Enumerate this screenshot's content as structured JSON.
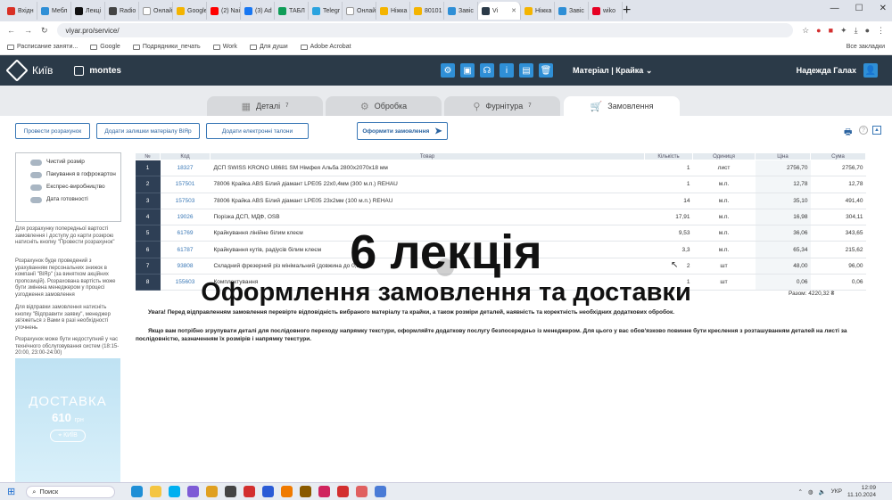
{
  "browser": {
    "tabs": [
      {
        "label": "Вхідн",
        "color": "#d93025"
      },
      {
        "label": "Мебл",
        "color": "#2f8fd6"
      },
      {
        "label": "Лекці",
        "color": "#111111"
      },
      {
        "label": "Radio",
        "color": "#444444"
      },
      {
        "label": "Онлай",
        "color": "#ffffff"
      },
      {
        "label": "Google",
        "color": "#f4b400"
      },
      {
        "label": "(2) Nai",
        "color": "#ff0000"
      },
      {
        "label": "(3) Ad",
        "color": "#1877f2"
      },
      {
        "label": "ТАБЛ",
        "color": "#0f9d58"
      },
      {
        "label": "Telegr",
        "color": "#2aa3df"
      },
      {
        "label": "Онлай",
        "color": "#ffffff"
      },
      {
        "label": "Ніжка",
        "color": "#f4b400"
      },
      {
        "label": "80101",
        "color": "#f4b400"
      },
      {
        "label": "Завіс",
        "color": "#2f8fd6"
      },
      {
        "label": "Vi",
        "color": "#2b3a48",
        "active": true
      },
      {
        "label": "Ніжка",
        "color": "#f4b400"
      },
      {
        "label": "Завіс",
        "color": "#2f8fd6"
      },
      {
        "label": "wiko",
        "color": "#e60023"
      }
    ],
    "new_tab": "+",
    "window_controls": [
      "—",
      "☐",
      "✕"
    ],
    "url": "viyar.pro/service/",
    "bookmarks": [
      {
        "label": "Расписание заняти...",
        "icon": "calendar-icon"
      },
      {
        "label": "Google",
        "icon": "google-icon"
      },
      {
        "label": "Подрядники_печать",
        "icon": "folder-icon"
      },
      {
        "label": "Work",
        "icon": "folder-icon"
      },
      {
        "label": "Для души",
        "icon": "folder-icon"
      },
      {
        "label": "Adobe Acrobat",
        "icon": "acrobat-icon"
      }
    ],
    "bookmarks_all": "Все закладки"
  },
  "app": {
    "city": "Київ",
    "brand": "montes",
    "material_menu": "Матеріал | Крайка",
    "user_name": "Надежда Галах",
    "toolbar_icons": [
      "settings-icon",
      "save-icon",
      "support-icon",
      "info-icon",
      "document-icon",
      "delete-icon"
    ]
  },
  "steps": [
    {
      "label": "Деталі",
      "count": "7",
      "icon": "grid-icon"
    },
    {
      "label": "Обробка",
      "count": "",
      "icon": "gear-icon"
    },
    {
      "label": "Фурнітура",
      "count": "7",
      "icon": "handle-icon"
    },
    {
      "label": "Замовлення",
      "count": "",
      "icon": "cart-icon",
      "active": true
    }
  ],
  "actions": {
    "calc": "Провести розрахунок",
    "add_leftovers": "Додати залишки матеріалу ВіЯр",
    "add_labels": "Додати електронні талони",
    "checkout": "Оформити замовлення"
  },
  "filters": [
    {
      "label": "Чистий розмір"
    },
    {
      "label": "Пакування в гофрокартон"
    },
    {
      "label": "Експрес-виробництво"
    },
    {
      "label": "Дата готовності"
    }
  ],
  "side_notes": [
    "Для розрахунку попередньої вартості замовлення і доступу до карти розкрою натисніть кнопку \"Провести розрахунок\"",
    "Розрахунок буде проведений з урахуванням персональних знижок в компанії \"ВіЯр\" (за винятком акційних пропозицій). Розрахована вартість може бути змінена менеджером у процесі узгодження замовлення",
    "Для відправки замовлення натисніть кнопку \"Відправити заявку\", менеджер зв'яжеться з Вами в разі необхідності уточнень",
    "Розрахунок може бути недоступний у час технічного обслуговування систем (18:15-20:00, 23:00-24:00)"
  ],
  "promo": {
    "title": "ДОСТАВКА",
    "price": "610",
    "currency": "грн",
    "city": "КИЇВ"
  },
  "table": {
    "headers": [
      "№",
      "Код",
      "Товар",
      "Кількість",
      "Одиниця",
      "Ціна",
      "Сума"
    ],
    "rows": [
      {
        "n": "1",
        "code": "18327",
        "name": "ДСП SWISS KRONO U8681 SM Німфея Альба 2800x2070x18 мм",
        "qty": "1",
        "unit": "лист",
        "price": "2756,70",
        "sum": "2756,70"
      },
      {
        "n": "2",
        "code": "157501",
        "name": "78006 Крайка ABS Білий діамант LPE05 22x0,4мм (300 м.п.) REHAU",
        "qty": "1",
        "unit": "м.п.",
        "price": "12,78",
        "sum": "12,78"
      },
      {
        "n": "3",
        "code": "157503",
        "name": "78006 Крайка ABS Білий діамант LPE05 23x2мм (100 м.п.) REHAU",
        "qty": "14",
        "unit": "м.п.",
        "price": "35,10",
        "sum": "491,40"
      },
      {
        "n": "4",
        "code": "19026",
        "name": "Порізка ДСП, МДФ, OSB",
        "qty": "17,91",
        "unit": "м.п.",
        "price": "16,98",
        "sum": "304,11"
      },
      {
        "n": "5",
        "code": "61769",
        "name": "Крайкування лінійне білим клеєм",
        "qty": "9,53",
        "unit": "м.п.",
        "price": "36,06",
        "sum": "343,65"
      },
      {
        "n": "6",
        "code": "61787",
        "name": "Крайкування кутів, радіусів білим клеєм",
        "qty": "3,3",
        "unit": "м.п.",
        "price": "65,34",
        "sum": "215,62"
      },
      {
        "n": "7",
        "code": "93808",
        "name": "Складний фрезерний різ мінімальний (довжина до 0,1м)",
        "qty": "2",
        "unit": "шт",
        "price": "48,00",
        "sum": "96,00"
      },
      {
        "n": "8",
        "code": "155603",
        "name": "Комплектування",
        "qty": "1",
        "unit": "шт",
        "price": "0,06",
        "sum": "0,06"
      }
    ],
    "total": "Разом: 4220,32 ₴"
  },
  "notes": {
    "warning": "Увага! Перед відправленням замовлення перевірте відповідність вибраного матеріалу та крайки, а також розміри деталей, наявність та коректність необхідних додаткових обробок.",
    "grouping": "Якщо вам потрібно згрупувати деталі для послідовного переходу напрямку текстури, оформляйте додаткову послугу безпосередньо із менеджером. Для цього у вас обов'язково повинне бути креслення з розташуванням деталей на листі за послідовністю, зазначенням їх розмірів і напрямку текстури."
  },
  "overlay": {
    "title": "6 лекція",
    "subtitle": "Оформлення замовлення та доставки"
  },
  "taskbar": {
    "search": "Поиск",
    "lang": "УКР",
    "time": "12:09",
    "date": "11.10.2024",
    "apps": [
      {
        "name": "edge-icon",
        "color": "#1f8fd6"
      },
      {
        "name": "explorer-icon",
        "color": "#f4c542"
      },
      {
        "name": "skype-icon",
        "color": "#00aff0"
      },
      {
        "name": "viber-icon",
        "color": "#7d5bd6"
      },
      {
        "name": "chrome-icon",
        "color": "#e0a020"
      },
      {
        "name": "app-icon",
        "color": "#444444"
      },
      {
        "name": "acrobat-icon",
        "color": "#d32f2f"
      },
      {
        "name": "photoshop-icon",
        "color": "#2a5bd6"
      },
      {
        "name": "illustrator-icon",
        "color": "#f07a00"
      },
      {
        "name": "bridge-icon",
        "color": "#8a5a00"
      },
      {
        "name": "indesign-icon",
        "color": "#d0245e"
      },
      {
        "name": "acrobat2-icon",
        "color": "#d32f2f"
      },
      {
        "name": "paint-icon",
        "color": "#e06060"
      },
      {
        "name": "media-icon",
        "color": "#4a7bd6"
      }
    ]
  }
}
